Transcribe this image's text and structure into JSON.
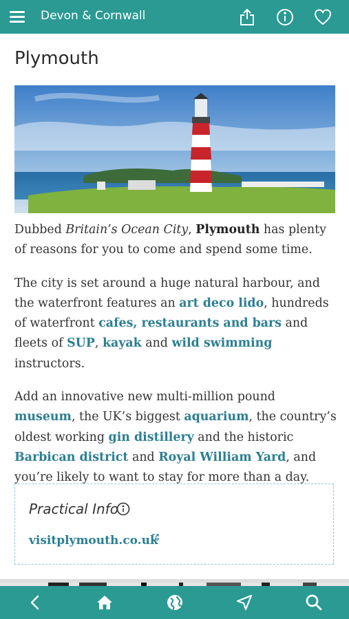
{
  "header": {
    "title": "Devon & Cornwall",
    "icons": [
      "menu-icon",
      "share-icon",
      "info-icon",
      "heart-icon"
    ]
  },
  "page": {
    "title": "Plymouth"
  },
  "hero_image": {
    "subject": "Red and white lighthouse on a grassy headland above the sea"
  },
  "body": {
    "p1": {
      "t1": "Dubbed ",
      "em1": "Britain’s Ocean City",
      "t2": ", ",
      "strong1": "Plymouth",
      "t3": " has plenty of reasons for you to come and spend some time."
    },
    "p2": {
      "t1": "The city is set around a huge natural harbour, and the waterfront features an ",
      "link1": "art deco lido",
      "t2": ", hundreds of waterfront ",
      "link2": "cafes, restaurants and bars",
      "t3": " and fleets of ",
      "link3": "SUP",
      "t4": ", ",
      "link4": "kayak",
      "t5": " and ",
      "link5": "wild swimming",
      "t6": " instructors."
    },
    "p3": {
      "t1": "Add an innovative new multi-million pound ",
      "link1": "museum",
      "t2": ", the UK’s biggest ",
      "link2": "aquarium",
      "t3": ", the country’s oldest working ",
      "link3": "gin distillery",
      "t4": " and the historic ",
      "link4": "Barbican district",
      "t5": " and ",
      "link5": "Royal William Yard",
      "t6": ", and you’re likely to want to stay for more than a day."
    }
  },
  "practical_info": {
    "title": "Practical Info",
    "link": "visitplymouth.co.uk"
  },
  "bottom_nav": {
    "icons": [
      "back-icon",
      "home-icon",
      "globe-icon",
      "location-arrow-icon",
      "search-icon"
    ]
  },
  "colors": {
    "brand": "#2a9a93",
    "link": "#2b7f92",
    "border": "#8fc8cc"
  }
}
